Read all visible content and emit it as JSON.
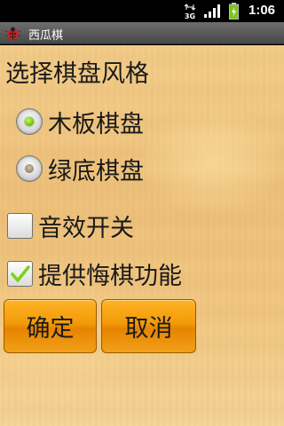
{
  "status_bar": {
    "network": "3G",
    "time": "1:06"
  },
  "title_bar": {
    "title": "西瓜棋"
  },
  "board_style": {
    "heading": "选择棋盘风格",
    "options": [
      {
        "label": "木板棋盘",
        "selected": true
      },
      {
        "label": "绿底棋盘",
        "selected": false
      }
    ]
  },
  "settings": {
    "sound": {
      "label": "音效开关",
      "checked": false
    },
    "undo": {
      "label": "提供悔棋功能",
      "checked": true
    }
  },
  "buttons": {
    "ok": "确定",
    "cancel": "取消"
  },
  "colors": {
    "button_orange": "#f29a08",
    "radio_selected": "#5fb800",
    "checkmark": "#7bd21a"
  }
}
